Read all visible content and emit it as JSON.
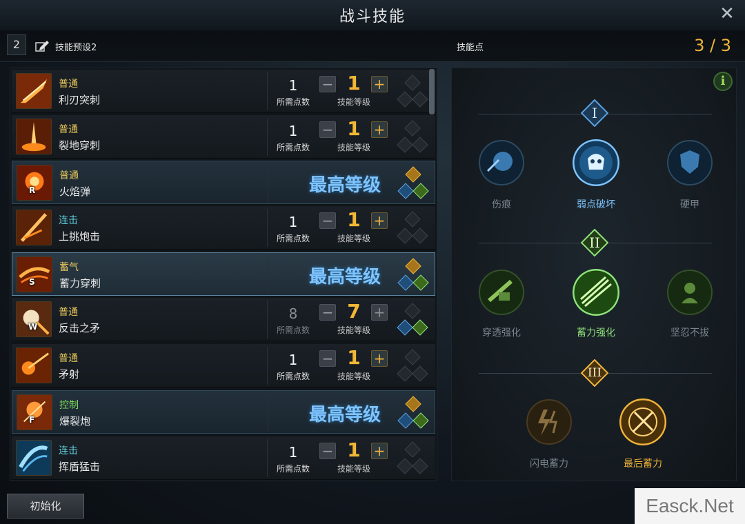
{
  "window": {
    "title": "战斗技能"
  },
  "preset": {
    "number": "2",
    "name": "技能预设2"
  },
  "points": {
    "label": "技能点",
    "value": "3 / 3"
  },
  "labels": {
    "cost": "所需点数",
    "level": "技能等级",
    "max": "最高等级",
    "reset": "初始化"
  },
  "skills": [
    {
      "type": "普通",
      "name": "利刃突刺",
      "cost": "1",
      "level": "1",
      "hotkey": ""
    },
    {
      "type": "普通",
      "name": "裂地穿刺",
      "cost": "1",
      "level": "1",
      "hotkey": ""
    },
    {
      "type": "普通",
      "name": "火焰弹",
      "hotkey": "R",
      "max": true
    },
    {
      "type": "连击",
      "name": "上挑炮击",
      "cost": "1",
      "level": "1",
      "hotkey": ""
    },
    {
      "type": "蓄气",
      "name": "蓄力穿刺",
      "hotkey": "S",
      "max": true
    },
    {
      "type": "普通",
      "name": "反击之矛",
      "cost": "8",
      "level": "7",
      "hotkey": "W"
    },
    {
      "type": "普通",
      "name": "矛射",
      "cost": "1",
      "level": "1",
      "hotkey": ""
    },
    {
      "type": "控制",
      "name": "爆裂炮",
      "hotkey": "F",
      "max": true
    },
    {
      "type": "连击",
      "name": "挥盾猛击",
      "cost": "1",
      "level": "1",
      "hotkey": ""
    }
  ],
  "tree": {
    "tier1": {
      "badge": "I",
      "nodes": [
        "伤痕",
        "弱点破坏",
        "硬甲"
      ]
    },
    "tier2": {
      "badge": "II",
      "nodes": [
        "穿透强化",
        "蓄力强化",
        "坚忍不拔"
      ]
    },
    "tier3": {
      "badge": "III",
      "nodes": [
        "闪电蓄力",
        "最后蓄力"
      ]
    },
    "info_icon": "i"
  },
  "watermark": "Easck.Net",
  "colors": {
    "gold": "#f0b43a",
    "blue": "#7fc4ff",
    "green": "#8ee27b",
    "type_yellow": "#e8c85a",
    "type_cyan": "#5fd0e0",
    "type_green": "#7ddc5a"
  }
}
